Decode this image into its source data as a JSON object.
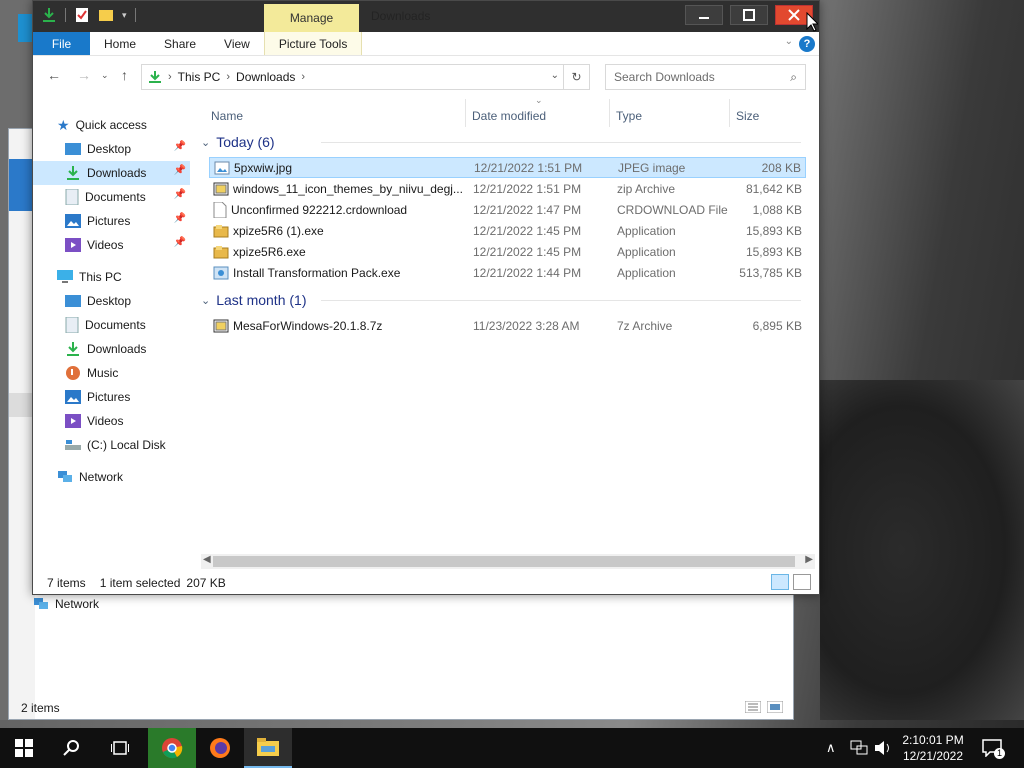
{
  "window": {
    "title": "Downloads",
    "manage_tab": "Manage",
    "context_tab": "Picture Tools"
  },
  "ribbon": {
    "tabs": [
      "File",
      "Home",
      "Share",
      "View",
      "Picture Tools"
    ],
    "help_label": "?"
  },
  "address": {
    "crumbs": [
      "This PC",
      "Downloads"
    ],
    "search_placeholder": "Search Downloads"
  },
  "nav": {
    "quick_access": "Quick access",
    "quick_items": [
      "Desktop",
      "Downloads",
      "Documents",
      "Pictures",
      "Videos"
    ],
    "this_pc": "This PC",
    "pc_items": [
      "Desktop",
      "Documents",
      "Downloads",
      "Music",
      "Pictures",
      "Videos",
      "(C:) Local Disk"
    ],
    "network": "Network"
  },
  "columns": {
    "name": "Name",
    "date": "Date modified",
    "type": "Type",
    "size": "Size"
  },
  "groups": [
    {
      "label": "Today (6)",
      "files": [
        {
          "name": "5pxwiw.jpg",
          "date": "12/21/2022 1:51 PM",
          "type": "JPEG image",
          "size": "208 KB"
        },
        {
          "name": "windows_11_icon_themes_by_niivu_degj...",
          "date": "12/21/2022 1:51 PM",
          "type": "zip Archive",
          "size": "81,642 KB"
        },
        {
          "name": "Unconfirmed 922212.crdownload",
          "date": "12/21/2022 1:47 PM",
          "type": "CRDOWNLOAD File",
          "size": "1,088 KB"
        },
        {
          "name": "xpize5R6 (1).exe",
          "date": "12/21/2022 1:45 PM",
          "type": "Application",
          "size": "15,893 KB"
        },
        {
          "name": "xpize5R6.exe",
          "date": "12/21/2022 1:45 PM",
          "type": "Application",
          "size": "15,893 KB"
        },
        {
          "name": "Install Transformation Pack.exe",
          "date": "12/21/2022 1:44 PM",
          "type": "Application",
          "size": "513,785 KB"
        }
      ]
    },
    {
      "label": "Last month (1)",
      "files": [
        {
          "name": "MesaForWindows-20.1.8.7z",
          "date": "11/23/2022 3:28 AM",
          "type": "7z Archive",
          "size": "6,895 KB"
        }
      ]
    }
  ],
  "status": {
    "count": "7 items",
    "selected": "1 item selected",
    "selected_size": "207 KB"
  },
  "back_window": {
    "network": "Network",
    "status": "2 items"
  },
  "taskbar": {
    "time": "2:10:01 PM",
    "date": "12/21/2022",
    "notif_count": "1"
  },
  "colors": {
    "accent": "#1979ca",
    "selection": "#cce8ff",
    "close": "#e2492f",
    "manage": "#f3ea9a"
  }
}
